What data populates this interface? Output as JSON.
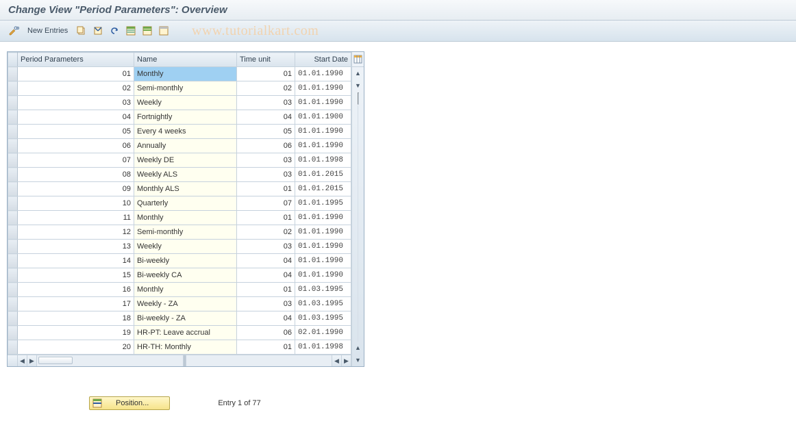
{
  "title": "Change View \"Period Parameters\": Overview",
  "watermark": "www.tutorialkart.com",
  "toolbar": {
    "new_entries_label": "New Entries",
    "icons": {
      "display_change": "display-change",
      "copy": "copy",
      "delete": "delete",
      "undo": "undo",
      "select_all": "select-all",
      "select_block": "select-block",
      "deselect": "deselect"
    }
  },
  "columns": {
    "period": "Period Parameters",
    "name": "Name",
    "timeunit": "Time unit",
    "startdate": "Start Date"
  },
  "rows": [
    {
      "period": "01",
      "name": "Monthly",
      "timeunit": "01",
      "startdate": "01.01.1990",
      "selected": true
    },
    {
      "period": "02",
      "name": "Semi-monthly",
      "timeunit": "02",
      "startdate": "01.01.1990"
    },
    {
      "period": "03",
      "name": "Weekly",
      "timeunit": "03",
      "startdate": "01.01.1990"
    },
    {
      "period": "04",
      "name": "Fortnightly",
      "timeunit": "04",
      "startdate": "01.01.1900"
    },
    {
      "period": "05",
      "name": "Every 4 weeks",
      "timeunit": "05",
      "startdate": "01.01.1990"
    },
    {
      "period": "06",
      "name": "Annually",
      "timeunit": "06",
      "startdate": "01.01.1990"
    },
    {
      "period": "07",
      "name": "Weekly  DE",
      "timeunit": "03",
      "startdate": "01.01.1998"
    },
    {
      "period": "08",
      "name": "Weekly ALS",
      "timeunit": "03",
      "startdate": "01.01.2015"
    },
    {
      "period": "09",
      "name": "Monthly ALS",
      "timeunit": "01",
      "startdate": "01.01.2015"
    },
    {
      "period": "10",
      "name": "Quarterly",
      "timeunit": "07",
      "startdate": "01.01.1995"
    },
    {
      "period": "11",
      "name": "Monthly",
      "timeunit": "01",
      "startdate": "01.01.1990"
    },
    {
      "period": "12",
      "name": "Semi-monthly",
      "timeunit": "02",
      "startdate": "01.01.1990"
    },
    {
      "period": "13",
      "name": "Weekly",
      "timeunit": "03",
      "startdate": "01.01.1990"
    },
    {
      "period": "14",
      "name": "Bi-weekly",
      "timeunit": "04",
      "startdate": "01.01.1990"
    },
    {
      "period": "15",
      "name": "Bi-weekly CA",
      "timeunit": "04",
      "startdate": "01.01.1990"
    },
    {
      "period": "16",
      "name": "Monthly",
      "timeunit": "01",
      "startdate": "01.03.1995"
    },
    {
      "period": "17",
      "name": "Weekly - ZA",
      "timeunit": "03",
      "startdate": "01.03.1995"
    },
    {
      "period": "18",
      "name": "Bi-weekly - ZA",
      "timeunit": "04",
      "startdate": "01.03.1995"
    },
    {
      "period": "19",
      "name": "HR-PT: Leave accrual",
      "timeunit": "06",
      "startdate": "02.01.1990"
    },
    {
      "period": "20",
      "name": "HR-TH: Monthly",
      "timeunit": "01",
      "startdate": "01.01.1998"
    }
  ],
  "footer": {
    "position_label": "Position...",
    "entry_status": "Entry 1 of 77"
  }
}
